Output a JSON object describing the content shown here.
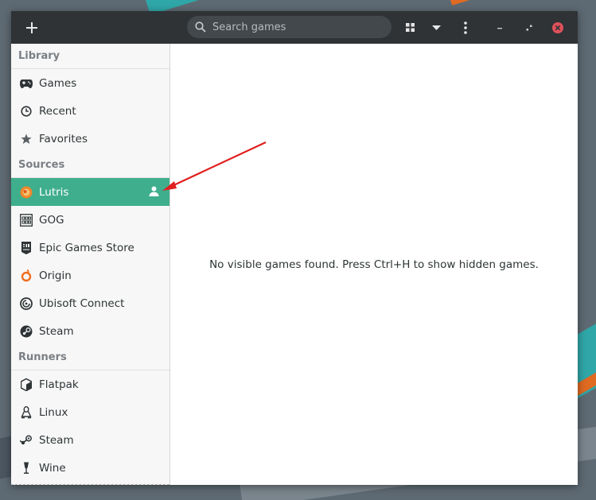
{
  "header": {
    "add_label": "+",
    "search_placeholder": "Search games"
  },
  "sidebar": {
    "library_title": "Library",
    "library_items": [
      {
        "label": "Games",
        "icon": "gamepad-icon"
      },
      {
        "label": "Recent",
        "icon": "clock-icon"
      },
      {
        "label": "Favorites",
        "icon": "star-icon"
      }
    ],
    "sources_title": "Sources",
    "source_items": [
      {
        "label": "Lutris",
        "icon": "lutris-icon",
        "active": true
      },
      {
        "label": "GOG",
        "icon": "gog-icon"
      },
      {
        "label": "Epic Games Store",
        "icon": "epic-icon"
      },
      {
        "label": "Origin",
        "icon": "origin-icon"
      },
      {
        "label": "Ubisoft Connect",
        "icon": "ubisoft-icon"
      },
      {
        "label": "Steam",
        "icon": "steam-icon"
      }
    ],
    "runners_title": "Runners",
    "runner_items": [
      {
        "label": "Flatpak",
        "icon": "flatpak-icon"
      },
      {
        "label": "Linux",
        "icon": "linux-icon"
      },
      {
        "label": "Steam",
        "icon": "steam-icon"
      },
      {
        "label": "Wine",
        "icon": "wine-icon"
      }
    ]
  },
  "main": {
    "empty_message": "No visible games found. Press Ctrl+H to show hidden games."
  },
  "colors": {
    "accent": "#3fae8c",
    "headerbar": "#2f3336",
    "annotation_arrow": "#e02020",
    "close_button": "#e0515a"
  }
}
